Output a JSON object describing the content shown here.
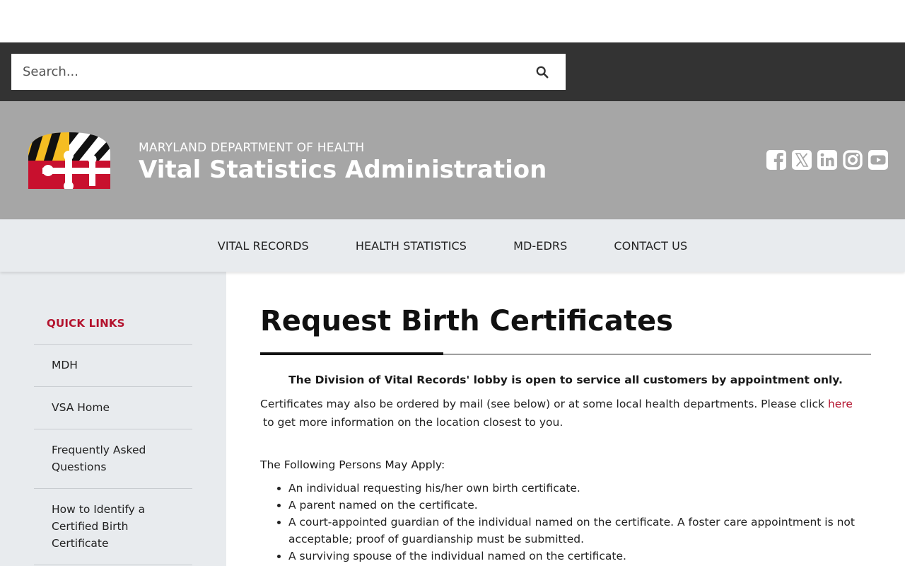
{
  "search": {
    "placeholder": "Search..."
  },
  "header": {
    "department": "MARYLAND DEPARTMENT OF HEALTH",
    "agency": "Vital Statistics Administration"
  },
  "social": [
    "facebook-icon",
    "x-twitter-icon",
    "linkedin-icon",
    "instagram-icon",
    "youtube-icon"
  ],
  "nav": {
    "items": [
      {
        "label": "VITAL RECORDS"
      },
      {
        "label": "HEALTH STATISTICS"
      },
      {
        "label": "MD-EDRS"
      },
      {
        "label": "CONTACT US"
      }
    ]
  },
  "sidebar": {
    "title": "QUICK LINKS",
    "items": [
      {
        "label": "MDH"
      },
      {
        "label": "VSA Home"
      },
      {
        "label": "Frequently Asked Questions"
      },
      {
        "label": "How to Identify a Certified Birth Certificate"
      }
    ]
  },
  "main": {
    "title": "Request Birth Certificates",
    "notice": "The Division of Vital Records' lobby is open to service all customers by appointment only.",
    "para_text": "Certificates may also be ordered by mail (see below) or at some local health departments. Please click ",
    "para_link": "here",
    "para_text2": "to get more information on the location closest to you.",
    "apply_title": "The Following Persons May Apply:",
    "persons": [
      "An individual requesting his/her own birth certificate.",
      "A parent named on the certificate.",
      "A court-appointed guardian of the individual named on the certificate. A foster care appointment is not acceptable; proof of guardianship must be submitted.",
      "A surviving spouse of the individual named on the certificate."
    ]
  },
  "colors": {
    "accent_red": "#b3122d",
    "top_bar": "#333333",
    "banner": "#a6a6a6",
    "nav_bg": "#e8ebee"
  }
}
